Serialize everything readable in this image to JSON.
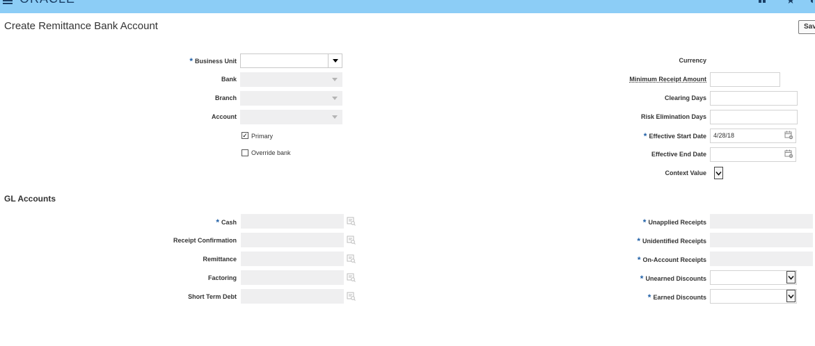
{
  "header": {
    "logo": "ORACLE"
  },
  "page": {
    "title": "Create Remittance Bank Account",
    "save_label": "Sav"
  },
  "left_fields": {
    "business_unit": "Business Unit",
    "bank": "Bank",
    "branch": "Branch",
    "account": "Account",
    "primary": "Primary",
    "override_bank": "Override bank",
    "primary_checked": "✓"
  },
  "right_fields": {
    "currency": "Currency",
    "minimum_receipt_amount": "Minimum Receipt Amount",
    "clearing_days": "Clearing Days",
    "risk_elimination_days": "Risk Elimination Days",
    "effective_start_date": "Effective Start Date",
    "effective_start_date_value": "4/28/18",
    "effective_end_date": "Effective End Date",
    "context_value": "Context Value"
  },
  "gl": {
    "title": "GL Accounts",
    "cash": "Cash",
    "receipt_confirmation": "Receipt Confirmation",
    "remittance": "Remittance",
    "factoring": "Factoring",
    "short_term_debt": "Short Term Debt",
    "unapplied_receipts": "Unapplied Receipts",
    "unidentified_receipts": "Unidentified Receipts",
    "on_account_receipts": "On-Account Receipts",
    "unearned_discounts": "Unearned Discounts",
    "earned_discounts": "Earned Discounts"
  },
  "required_marker": "*",
  "colors": {
    "header": "#8ccdf6",
    "required": "#1f5fa6",
    "readonly_field": "#efeff0"
  }
}
